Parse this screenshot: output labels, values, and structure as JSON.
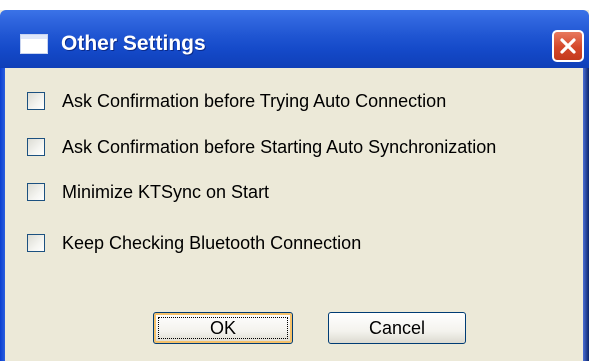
{
  "window": {
    "title": "Other Settings"
  },
  "options": [
    {
      "label": "Ask Confirmation before Trying Auto Connection",
      "checked": false
    },
    {
      "label": "Ask Confirmation before Starting Auto Synchronization",
      "checked": false
    },
    {
      "label": "Minimize KTSync on Start",
      "checked": false
    },
    {
      "label": "Keep Checking Bluetooth Connection",
      "checked": false
    }
  ],
  "buttons": {
    "ok_label": "OK",
    "cancel_label": "Cancel"
  },
  "icons": {
    "window": "window-icon",
    "close": "close-icon"
  },
  "colors": {
    "titlebar": "#1f55d2",
    "close_button": "#d4472a",
    "dialog_background": "#ece9d8"
  }
}
